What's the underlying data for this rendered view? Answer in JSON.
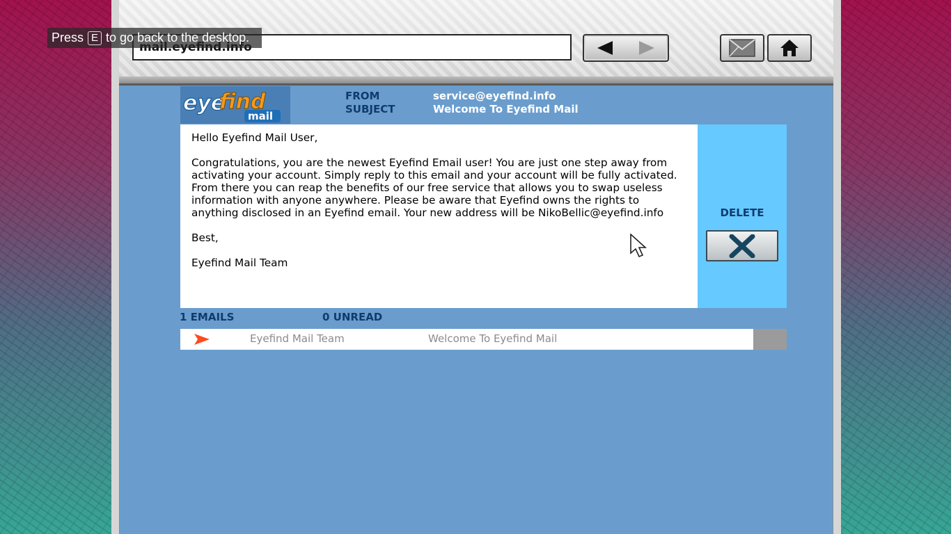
{
  "hint": {
    "prefix": "Press",
    "key": "E",
    "suffix": "to go back to the desktop."
  },
  "browser": {
    "address": "mail.eyefind.info"
  },
  "email": {
    "from_label": "FROM",
    "from_value": "service@eyefind.info",
    "subject_label": "SUBJECT",
    "subject_value": "Welcome To Eyefind Mail",
    "body": {
      "greeting": "Hello Eyefind Mail User,",
      "paragraph": "Congratulations, you are the newest Eyefind Email user! You are just one step away from activating your account. Simply reply to this email and your account will be fully activated. From there you can reap the benefits of our free service that allows you to swap useless information with anyone anywhere. Please be aware that Eyefind owns the rights to anything disclosed in an Eyefind email. Your new address will be NikoBellic@eyefind.info",
      "closing": "Best,",
      "signature": "Eyefind Mail Team"
    }
  },
  "actions": {
    "delete_label": "DELETE"
  },
  "inbox": {
    "total": "1 EMAILS",
    "unread": "0 UNREAD",
    "rows": [
      {
        "sender": "Eyefind Mail Team",
        "subject": "Welcome To Eyefind Mail"
      }
    ]
  },
  "logo": {
    "word1": "eye",
    "word2": "find",
    "word3": "mail"
  },
  "colors": {
    "panel": "#6a9dcd",
    "sidebar": "#66c9ff",
    "label": "#103b6d",
    "logo_orange": "#f29a1f"
  }
}
